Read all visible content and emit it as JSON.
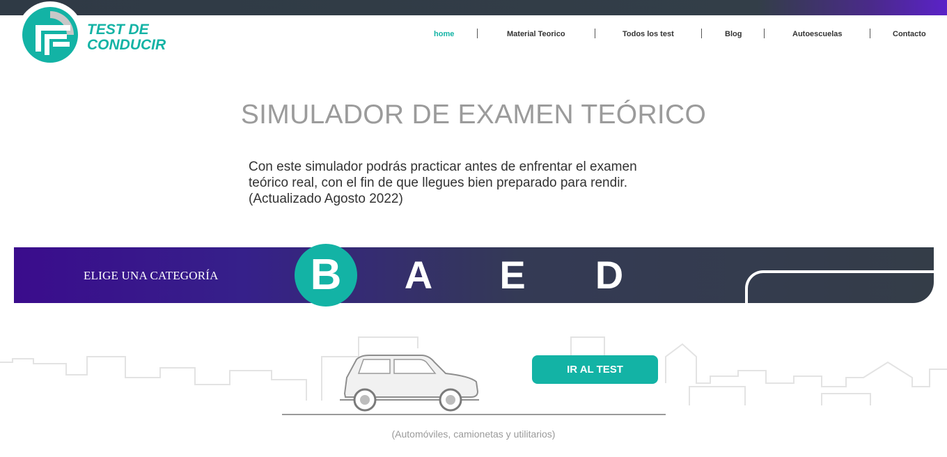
{
  "header": {
    "logo_text_line1": "TEST DE",
    "logo_text_line2": "CONDUCIR",
    "brand_color": "#13b3a5",
    "nav": [
      {
        "label": "home",
        "active": true
      },
      {
        "label": "Material Teorico",
        "active": false
      },
      {
        "label": "Todos los test",
        "active": false
      },
      {
        "label": "Blog",
        "active": false
      },
      {
        "label": "Autoescuelas",
        "active": false
      },
      {
        "label": "Contacto",
        "active": false
      }
    ]
  },
  "main": {
    "title": "SIMULADOR DE EXAMEN TEÓRICO",
    "intro_line1": "Con este simulador podrás practicar antes de enfrentar el examen",
    "intro_line2": "teórico real, con el fin de que llegues bien preparado para rendir.",
    "intro_line3": "(Actualizado Agosto 2022)"
  },
  "categories": {
    "label": "ELIGE UNA CATEGORÍA",
    "items": [
      {
        "letter": "B",
        "selected": true
      },
      {
        "letter": "A",
        "selected": false
      },
      {
        "letter": "E",
        "selected": false
      },
      {
        "letter": "D",
        "selected": false
      }
    ]
  },
  "selection": {
    "button_label": "IR AL TEST",
    "caption": "(Automóviles, camionetas y utilitarios)",
    "illustration": "car-icon"
  }
}
